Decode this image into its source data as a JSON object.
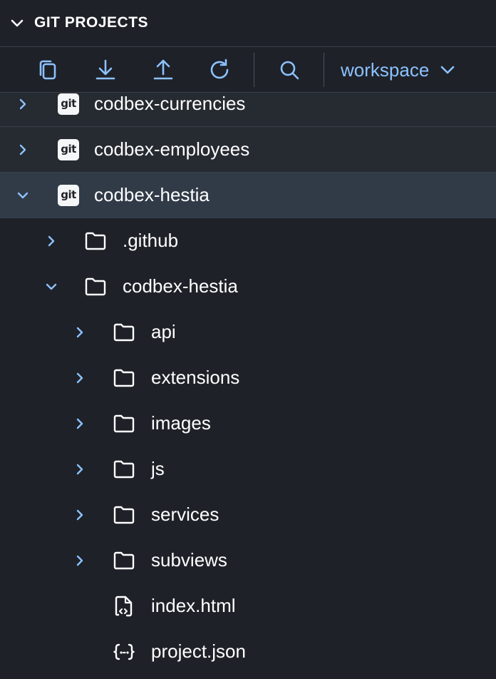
{
  "panel": {
    "title": "GIT PROJECTS"
  },
  "toolbar": {
    "workspace_label": "workspace",
    "buttons": [
      "copy-icon",
      "download-icon",
      "upload-icon",
      "refresh-icon",
      "search-icon"
    ]
  },
  "colors": {
    "background": "#1e2128",
    "repo_row": "#262a31",
    "selected_row": "#313b48",
    "accent": "#8cc2ff",
    "text": "#ffffff"
  },
  "tree": {
    "repos": [
      {
        "label": "codbex-currencies",
        "badge": "git",
        "expanded": false
      },
      {
        "label": "codbex-employees",
        "badge": "git",
        "expanded": false
      },
      {
        "label": "codbex-hestia",
        "badge": "git",
        "expanded": true,
        "selected": true
      }
    ],
    "items": [
      {
        "label": ".github",
        "type": "folder",
        "expanded": false
      },
      {
        "label": "codbex-hestia",
        "type": "folder",
        "expanded": true
      },
      {
        "label": "api",
        "type": "folder",
        "expanded": false
      },
      {
        "label": "extensions",
        "type": "folder",
        "expanded": false
      },
      {
        "label": "images",
        "type": "folder",
        "expanded": false
      },
      {
        "label": "js",
        "type": "folder",
        "expanded": false
      },
      {
        "label": "services",
        "type": "folder",
        "expanded": false
      },
      {
        "label": "subviews",
        "type": "folder",
        "expanded": false
      },
      {
        "label": "index.html",
        "type": "html-file"
      },
      {
        "label": "project.json",
        "type": "json-file"
      }
    ]
  }
}
